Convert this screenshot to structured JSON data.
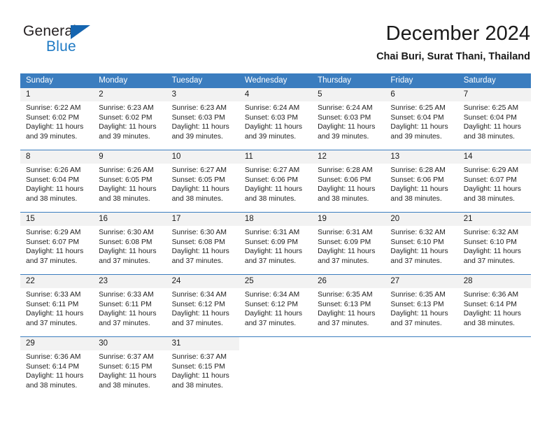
{
  "brand": {
    "name_part1": "General",
    "name_part2": "Blue",
    "triangle_icon": "blue-triangle-icon",
    "accent_color": "#1f7ac4"
  },
  "header": {
    "title": "December 2024",
    "subtitle": "Chai Buri, Surat Thani, Thailand"
  },
  "colors": {
    "header_blue": "#3b7dbf",
    "day_band_gray": "#f2f2f2",
    "text": "#1a1a1a"
  },
  "calendar": {
    "weekdays": [
      "Sunday",
      "Monday",
      "Tuesday",
      "Wednesday",
      "Thursday",
      "Friday",
      "Saturday"
    ],
    "weeks": [
      [
        {
          "day": "1",
          "sunrise": "Sunrise: 6:22 AM",
          "sunset": "Sunset: 6:02 PM",
          "daylight_line1": "Daylight: 11 hours",
          "daylight_line2": "and 39 minutes."
        },
        {
          "day": "2",
          "sunrise": "Sunrise: 6:23 AM",
          "sunset": "Sunset: 6:02 PM",
          "daylight_line1": "Daylight: 11 hours",
          "daylight_line2": "and 39 minutes."
        },
        {
          "day": "3",
          "sunrise": "Sunrise: 6:23 AM",
          "sunset": "Sunset: 6:03 PM",
          "daylight_line1": "Daylight: 11 hours",
          "daylight_line2": "and 39 minutes."
        },
        {
          "day": "4",
          "sunrise": "Sunrise: 6:24 AM",
          "sunset": "Sunset: 6:03 PM",
          "daylight_line1": "Daylight: 11 hours",
          "daylight_line2": "and 39 minutes."
        },
        {
          "day": "5",
          "sunrise": "Sunrise: 6:24 AM",
          "sunset": "Sunset: 6:03 PM",
          "daylight_line1": "Daylight: 11 hours",
          "daylight_line2": "and 39 minutes."
        },
        {
          "day": "6",
          "sunrise": "Sunrise: 6:25 AM",
          "sunset": "Sunset: 6:04 PM",
          "daylight_line1": "Daylight: 11 hours",
          "daylight_line2": "and 39 minutes."
        },
        {
          "day": "7",
          "sunrise": "Sunrise: 6:25 AM",
          "sunset": "Sunset: 6:04 PM",
          "daylight_line1": "Daylight: 11 hours",
          "daylight_line2": "and 38 minutes."
        }
      ],
      [
        {
          "day": "8",
          "sunrise": "Sunrise: 6:26 AM",
          "sunset": "Sunset: 6:04 PM",
          "daylight_line1": "Daylight: 11 hours",
          "daylight_line2": "and 38 minutes."
        },
        {
          "day": "9",
          "sunrise": "Sunrise: 6:26 AM",
          "sunset": "Sunset: 6:05 PM",
          "daylight_line1": "Daylight: 11 hours",
          "daylight_line2": "and 38 minutes."
        },
        {
          "day": "10",
          "sunrise": "Sunrise: 6:27 AM",
          "sunset": "Sunset: 6:05 PM",
          "daylight_line1": "Daylight: 11 hours",
          "daylight_line2": "and 38 minutes."
        },
        {
          "day": "11",
          "sunrise": "Sunrise: 6:27 AM",
          "sunset": "Sunset: 6:06 PM",
          "daylight_line1": "Daylight: 11 hours",
          "daylight_line2": "and 38 minutes."
        },
        {
          "day": "12",
          "sunrise": "Sunrise: 6:28 AM",
          "sunset": "Sunset: 6:06 PM",
          "daylight_line1": "Daylight: 11 hours",
          "daylight_line2": "and 38 minutes."
        },
        {
          "day": "13",
          "sunrise": "Sunrise: 6:28 AM",
          "sunset": "Sunset: 6:06 PM",
          "daylight_line1": "Daylight: 11 hours",
          "daylight_line2": "and 38 minutes."
        },
        {
          "day": "14",
          "sunrise": "Sunrise: 6:29 AM",
          "sunset": "Sunset: 6:07 PM",
          "daylight_line1": "Daylight: 11 hours",
          "daylight_line2": "and 38 minutes."
        }
      ],
      [
        {
          "day": "15",
          "sunrise": "Sunrise: 6:29 AM",
          "sunset": "Sunset: 6:07 PM",
          "daylight_line1": "Daylight: 11 hours",
          "daylight_line2": "and 37 minutes."
        },
        {
          "day": "16",
          "sunrise": "Sunrise: 6:30 AM",
          "sunset": "Sunset: 6:08 PM",
          "daylight_line1": "Daylight: 11 hours",
          "daylight_line2": "and 37 minutes."
        },
        {
          "day": "17",
          "sunrise": "Sunrise: 6:30 AM",
          "sunset": "Sunset: 6:08 PM",
          "daylight_line1": "Daylight: 11 hours",
          "daylight_line2": "and 37 minutes."
        },
        {
          "day": "18",
          "sunrise": "Sunrise: 6:31 AM",
          "sunset": "Sunset: 6:09 PM",
          "daylight_line1": "Daylight: 11 hours",
          "daylight_line2": "and 37 minutes."
        },
        {
          "day": "19",
          "sunrise": "Sunrise: 6:31 AM",
          "sunset": "Sunset: 6:09 PM",
          "daylight_line1": "Daylight: 11 hours",
          "daylight_line2": "and 37 minutes."
        },
        {
          "day": "20",
          "sunrise": "Sunrise: 6:32 AM",
          "sunset": "Sunset: 6:10 PM",
          "daylight_line1": "Daylight: 11 hours",
          "daylight_line2": "and 37 minutes."
        },
        {
          "day": "21",
          "sunrise": "Sunrise: 6:32 AM",
          "sunset": "Sunset: 6:10 PM",
          "daylight_line1": "Daylight: 11 hours",
          "daylight_line2": "and 37 minutes."
        }
      ],
      [
        {
          "day": "22",
          "sunrise": "Sunrise: 6:33 AM",
          "sunset": "Sunset: 6:11 PM",
          "daylight_line1": "Daylight: 11 hours",
          "daylight_line2": "and 37 minutes."
        },
        {
          "day": "23",
          "sunrise": "Sunrise: 6:33 AM",
          "sunset": "Sunset: 6:11 PM",
          "daylight_line1": "Daylight: 11 hours",
          "daylight_line2": "and 37 minutes."
        },
        {
          "day": "24",
          "sunrise": "Sunrise: 6:34 AM",
          "sunset": "Sunset: 6:12 PM",
          "daylight_line1": "Daylight: 11 hours",
          "daylight_line2": "and 37 minutes."
        },
        {
          "day": "25",
          "sunrise": "Sunrise: 6:34 AM",
          "sunset": "Sunset: 6:12 PM",
          "daylight_line1": "Daylight: 11 hours",
          "daylight_line2": "and 37 minutes."
        },
        {
          "day": "26",
          "sunrise": "Sunrise: 6:35 AM",
          "sunset": "Sunset: 6:13 PM",
          "daylight_line1": "Daylight: 11 hours",
          "daylight_line2": "and 37 minutes."
        },
        {
          "day": "27",
          "sunrise": "Sunrise: 6:35 AM",
          "sunset": "Sunset: 6:13 PM",
          "daylight_line1": "Daylight: 11 hours",
          "daylight_line2": "and 37 minutes."
        },
        {
          "day": "28",
          "sunrise": "Sunrise: 6:36 AM",
          "sunset": "Sunset: 6:14 PM",
          "daylight_line1": "Daylight: 11 hours",
          "daylight_line2": "and 38 minutes."
        }
      ],
      [
        {
          "day": "29",
          "sunrise": "Sunrise: 6:36 AM",
          "sunset": "Sunset: 6:14 PM",
          "daylight_line1": "Daylight: 11 hours",
          "daylight_line2": "and 38 minutes."
        },
        {
          "day": "30",
          "sunrise": "Sunrise: 6:37 AM",
          "sunset": "Sunset: 6:15 PM",
          "daylight_line1": "Daylight: 11 hours",
          "daylight_line2": "and 38 minutes."
        },
        {
          "day": "31",
          "sunrise": "Sunrise: 6:37 AM",
          "sunset": "Sunset: 6:15 PM",
          "daylight_line1": "Daylight: 11 hours",
          "daylight_line2": "and 38 minutes."
        },
        {
          "day": "",
          "sunrise": "",
          "sunset": "",
          "daylight_line1": "",
          "daylight_line2": ""
        },
        {
          "day": "",
          "sunrise": "",
          "sunset": "",
          "daylight_line1": "",
          "daylight_line2": ""
        },
        {
          "day": "",
          "sunrise": "",
          "sunset": "",
          "daylight_line1": "",
          "daylight_line2": ""
        },
        {
          "day": "",
          "sunrise": "",
          "sunset": "",
          "daylight_line1": "",
          "daylight_line2": ""
        }
      ]
    ]
  }
}
